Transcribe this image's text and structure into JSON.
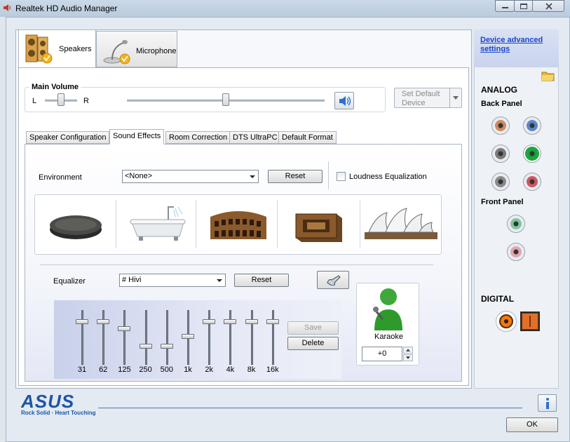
{
  "window": {
    "title": "Realtek HD Audio Manager"
  },
  "device_tabs": [
    {
      "label": "Speakers",
      "selected": true
    },
    {
      "label": "Microphone",
      "selected": false
    }
  ],
  "main_volume": {
    "label": "Main Volume",
    "left_label": "L",
    "right_label": "R",
    "balance": 0.5,
    "level": 0.5
  },
  "set_default": {
    "label_line1": "Set Default",
    "label_line2": "Device"
  },
  "inner_tabs": [
    {
      "label": "Speaker Configuration"
    },
    {
      "label": "Sound Effects",
      "selected": true
    },
    {
      "label": "Room Correction"
    },
    {
      "label": "DTS UltraPC"
    },
    {
      "label": "Default Format"
    }
  ],
  "environment": {
    "label": "Environment",
    "value": "<None>",
    "reset_label": "Reset",
    "loudness_label": "Loudness Equalization",
    "loudness_checked": false,
    "presets": [
      "stone-disc",
      "bathtub",
      "colosseum",
      "wooden-box",
      "opera-house"
    ]
  },
  "equalizer": {
    "label": "Equalizer",
    "value": "# Hivi",
    "reset_label": "Reset",
    "save_label": "Save",
    "delete_label": "Delete",
    "bands": [
      {
        "freq": "31",
        "level": 0.85
      },
      {
        "freq": "62",
        "level": 0.85
      },
      {
        "freq": "125",
        "level": 0.7
      },
      {
        "freq": "250",
        "level": 0.35
      },
      {
        "freq": "500",
        "level": 0.35
      },
      {
        "freq": "1k",
        "level": 0.55
      },
      {
        "freq": "2k",
        "level": 0.85
      },
      {
        "freq": "4k",
        "level": 0.85
      },
      {
        "freq": "8k",
        "level": 0.85
      },
      {
        "freq": "16k",
        "level": 0.85
      }
    ]
  },
  "karaoke": {
    "label": "Karaoke",
    "value": "+0"
  },
  "sidebar": {
    "device_advanced": "Device advanced settings",
    "analog_title": "ANALOG",
    "back_panel": "Back Panel",
    "front_panel": "Front Panel",
    "digital_title": "DIGITAL",
    "back_jacks": [
      {
        "color": "#d08a5c",
        "active": false
      },
      {
        "color": "#5d86c9",
        "active": false
      },
      {
        "color": "#7a7a7a",
        "active": false
      },
      {
        "color": "#17a33a",
        "active": true
      },
      {
        "color": "#8a8a8a",
        "active": false
      },
      {
        "color": "#d25560",
        "active": false
      }
    ],
    "front_jacks": [
      {
        "color": "#7fc79a",
        "active": false
      },
      {
        "color": "#e2a6b0",
        "active": false
      }
    ]
  },
  "footer": {
    "brand": "ASUS",
    "tagline": "Rock Solid · Heart Touching",
    "ok_label": "OK"
  },
  "colors": {
    "accent": "#1a46c8",
    "brand_blue": "#1c54a8"
  }
}
